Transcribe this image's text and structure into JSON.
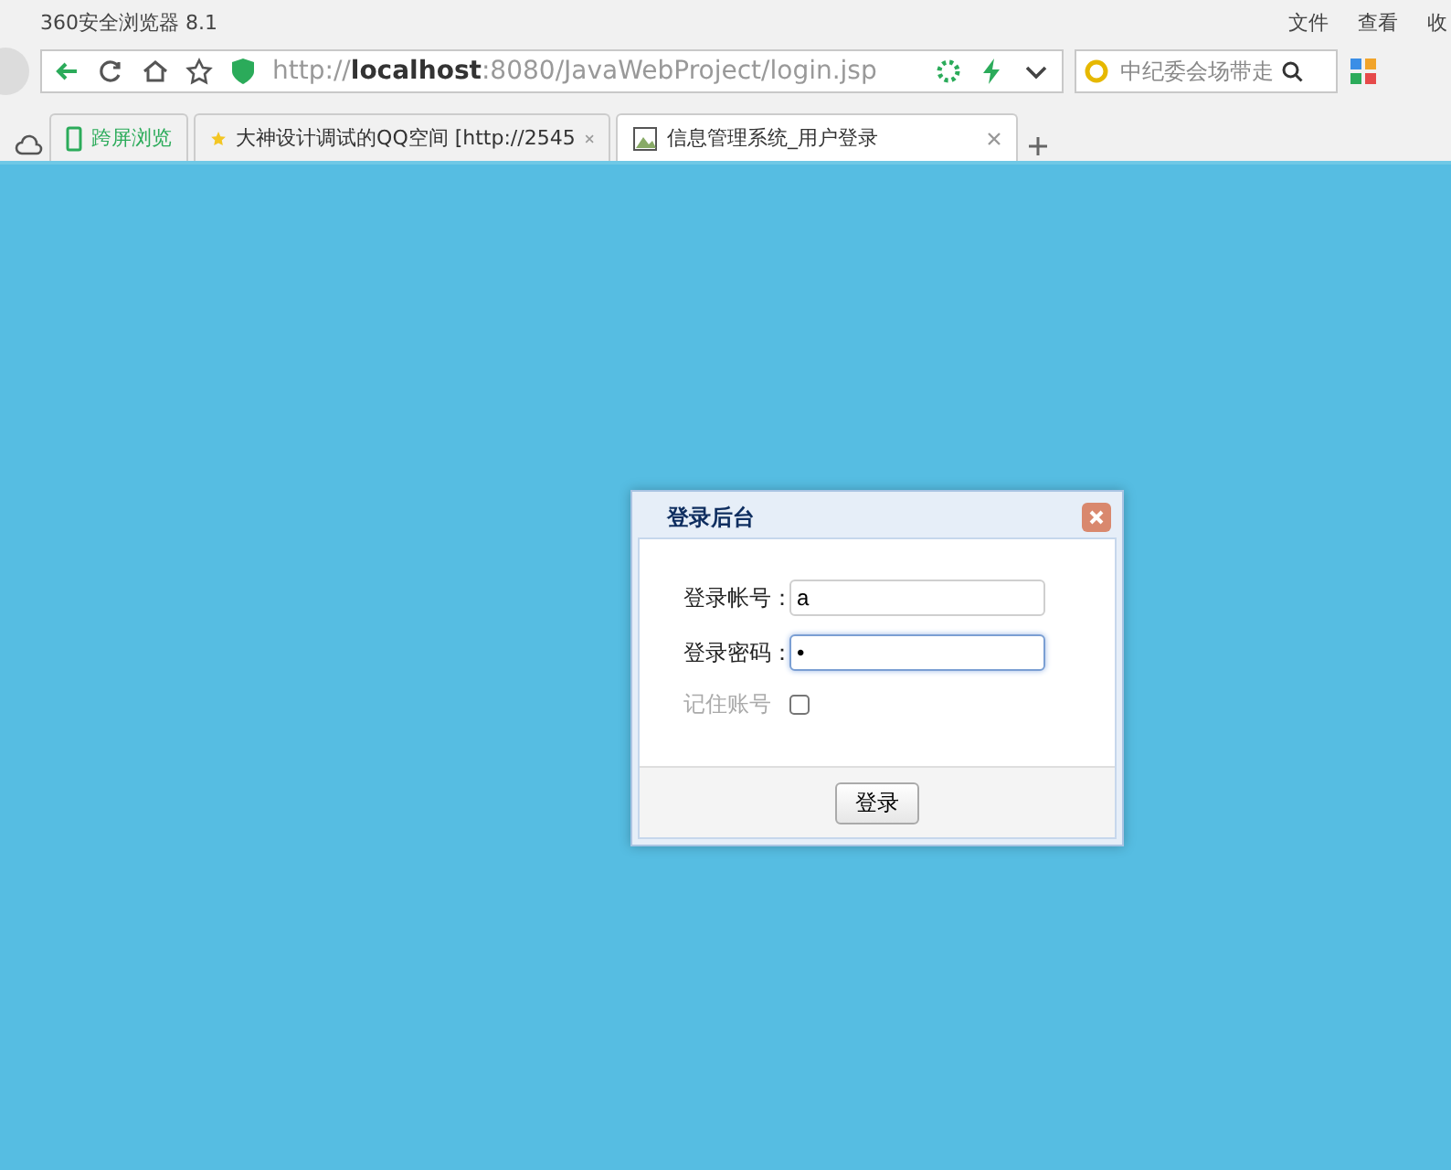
{
  "window": {
    "title": "360安全浏览器 8.1",
    "menu": [
      "文件",
      "查看",
      "收"
    ]
  },
  "address_bar": {
    "url": "http://**localhost**:8080/JavaWebProject/login.jsp",
    "search_placeholder": "中纪委会场带走"
  },
  "tabs": [
    {
      "kind": "pinned",
      "label": "跨屏浏览",
      "selected": false
    },
    {
      "kind": "page",
      "label": "大神设计调试的QQ空间 [http://2545",
      "selected": false
    },
    {
      "kind": "page",
      "label": "信息管理系统_用户登录",
      "selected": true
    }
  ],
  "dialog": {
    "title": "登录后台",
    "fields": [
      {
        "label": "登录帐号：",
        "value": "a",
        "focused": false
      },
      {
        "label": "登录密码：",
        "value": "•",
        "focused": true
      }
    ],
    "remember": {
      "label": "记住账号",
      "checked": false
    },
    "submit": "登录"
  }
}
